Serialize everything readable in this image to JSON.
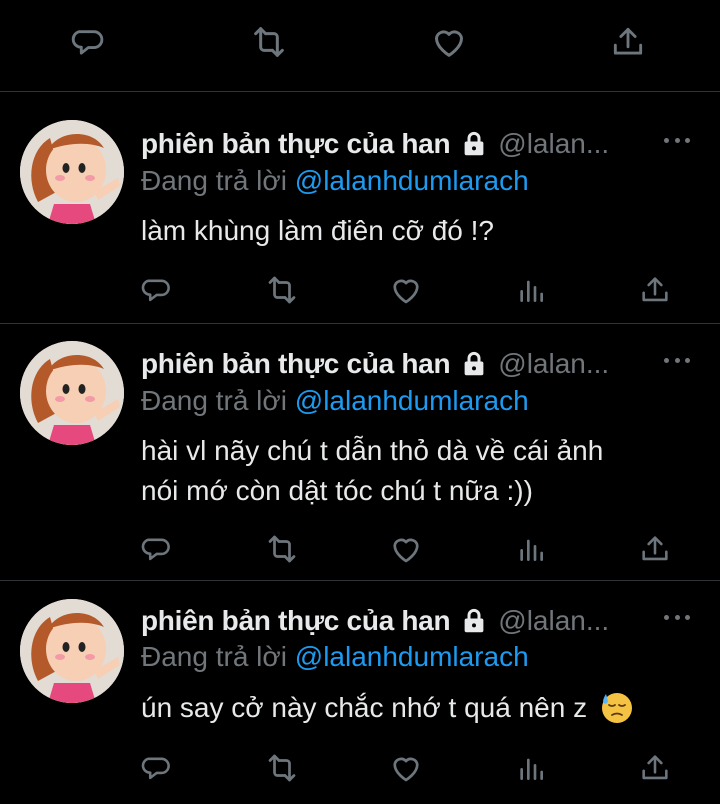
{
  "colors": {
    "background": "#000000",
    "divider": "#2f3336",
    "text_primary": "#e7e9ea",
    "text_secondary": "#71767b",
    "accent_link": "#1d9bf0"
  },
  "top_actions": {
    "icons": [
      "reply-icon",
      "retweet-icon",
      "like-icon",
      "share-icon"
    ]
  },
  "tweets": [
    {
      "display_name": "phiên bản thực của han",
      "handle": "@lalan...",
      "replying_prefix": "Đang trả lời",
      "replying_to": "@lalanhdumlarach",
      "text": "làm khùng làm điên cỡ đó !?",
      "icons": [
        "reply-icon",
        "retweet-icon",
        "like-icon",
        "analytics-icon",
        "share-icon"
      ]
    },
    {
      "display_name": "phiên bản thực của han",
      "handle": "@lalan...",
      "replying_prefix": "Đang trả lời",
      "replying_to": "@lalanhdumlarach",
      "text_line1": "hài vl nãy chú t dẫn thỏ dà về cái ảnh",
      "text_line2": "nói mớ còn dật tóc chú t nữa :))",
      "icons": [
        "reply-icon",
        "retweet-icon",
        "like-icon",
        "analytics-icon",
        "share-icon"
      ]
    },
    {
      "display_name": "phiên bản thực của han",
      "handle": "@lalan...",
      "replying_prefix": "Đang trả lời",
      "replying_to": "@lalanhdumlarach",
      "text": "ún say cở này chắc nhớ t quá nên z",
      "emoji": "downcast-face-with-sweat-emoji",
      "icons": [
        "reply-icon",
        "retweet-icon",
        "like-icon",
        "analytics-icon",
        "share-icon"
      ]
    }
  ]
}
